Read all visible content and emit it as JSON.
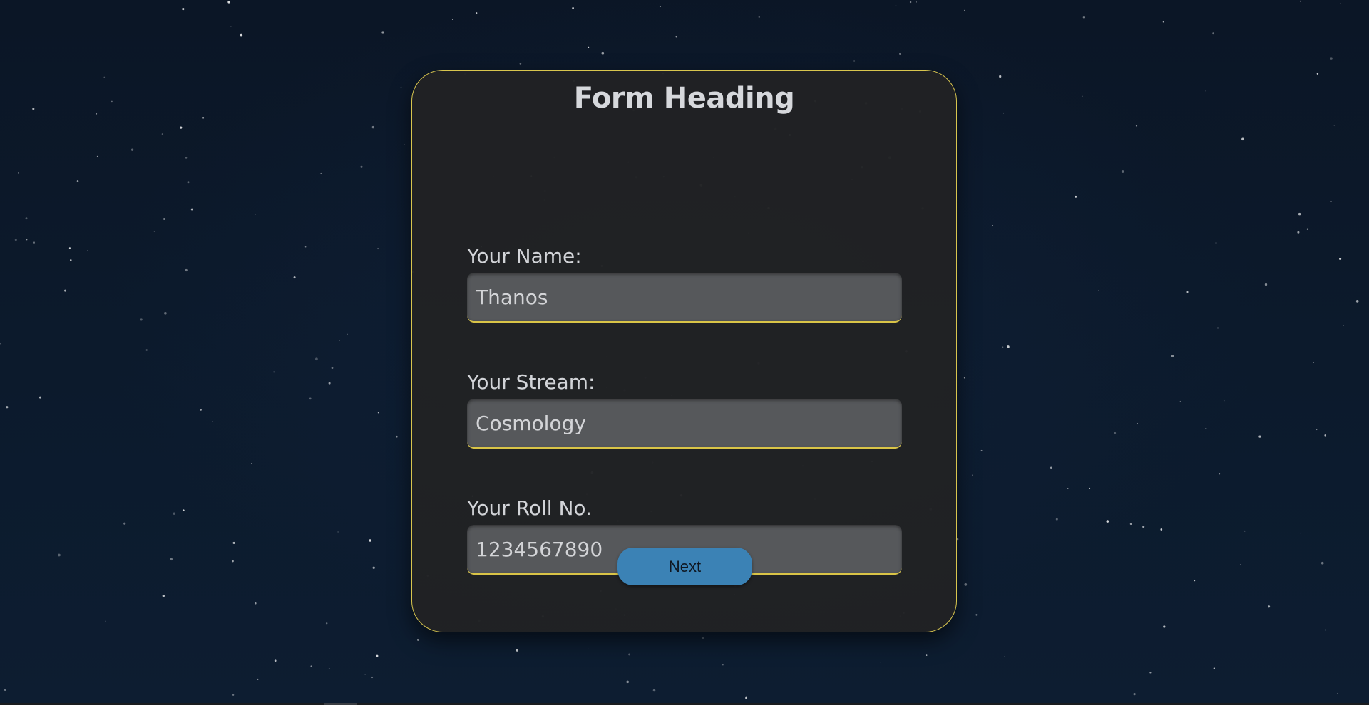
{
  "form": {
    "heading": "Form Heading",
    "fields": [
      {
        "label": "Your Name:",
        "value": "Thanos"
      },
      {
        "label": "Your Stream:",
        "value": "Cosmology"
      },
      {
        "label": "Your Roll No.",
        "value": "1234567890"
      }
    ],
    "next_label": "Next"
  },
  "colors": {
    "background": "#0c1a2c",
    "card": "#212224",
    "card_border": "#d8c54e",
    "input_background": "#56585b",
    "input_underline": "#d9c447",
    "button": "#3b82b5"
  }
}
